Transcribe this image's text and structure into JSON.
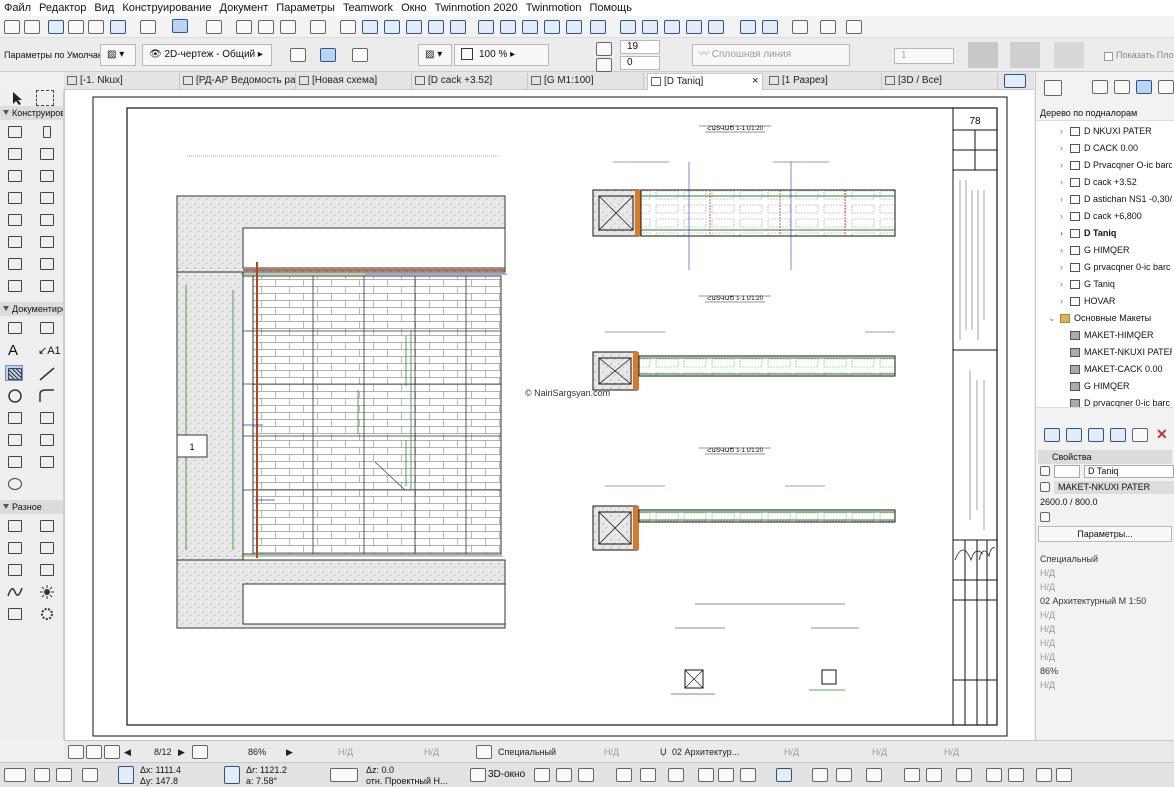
{
  "menu": [
    "Файл",
    "Редактор",
    "Вид",
    "Конструирование",
    "Документ",
    "Параметры",
    "Teamwork",
    "Окно",
    "Twinmotion 2020",
    "Twinmotion",
    "Помощь"
  ],
  "infobox": {
    "defaults_label": "Параметры по Умолчанию",
    "view_type": "2D-чертеж - Общий",
    "scale_pct": "100 %",
    "value_1": "19",
    "value_2": "0",
    "line_type": "Сплошная линия",
    "value_3": "1",
    "show_checkbox": "Показать Площ"
  },
  "tabs": [
    {
      "label": "[-1. Nkux]"
    },
    {
      "label": "[РД-АР Ведомость ра..."
    },
    {
      "label": "[Новая схема]"
    },
    {
      "label": "[D cack +3.52]"
    },
    {
      "label": "[G M1:100]"
    },
    {
      "label": "[D Taniq]",
      "active": true
    },
    {
      "label": "[1 Разрез]"
    },
    {
      "label": "[3D / Все]"
    }
  ],
  "tab_close": "×",
  "toolbox": {
    "sections": [
      "Конструирова",
      "Документиро",
      "Разное"
    ],
    "label_tool": "A1"
  },
  "drawing": {
    "sheet_number": "78",
    "watermark": "© NairiSargsyan.com",
    "detail_number": "1",
    "section_titles": [
      "ՀԱՏՎԱԾ 1-1 Մ1:20",
      "ՀԱՏՎԱԾ 1-1 Մ1:20",
      "ՀԱՏՎԱԾ 1-1 Մ1:20"
    ]
  },
  "navigator": {
    "header": "Дерево по подналорам",
    "items": [
      {
        "label": "D NKUXI PATER"
      },
      {
        "label": "D CACK 0.00"
      },
      {
        "label": "D Prvacqner O-ic barc"
      },
      {
        "label": "D cack +3.52"
      },
      {
        "label": "D astichan NS1 -0,30/"
      },
      {
        "label": "D cack +6,800"
      },
      {
        "label": "D Taniq",
        "selected": true
      },
      {
        "label": "G HIMQER"
      },
      {
        "label": "G prvacqner 0-ic barc"
      },
      {
        "label": "G Taniq"
      },
      {
        "label": "HOVAR"
      }
    ],
    "folder": "Основные Макеты",
    "layouts": [
      {
        "label": "MAKET-HIMQER"
      },
      {
        "label": "MAKET-NKUXI PATER"
      },
      {
        "label": "MAKET-CACK 0.00"
      },
      {
        "label": "G HIMQER"
      },
      {
        "label": "D prvacqner 0-ic barc"
      }
    ]
  },
  "properties": {
    "header": "Свойства",
    "name": "D Taniq",
    "layout": "MAKET-NKUXI PATER",
    "size": "2600.0 / 800.0",
    "params_button": "Параметры...",
    "list": [
      {
        "label": "Специальный",
        "dim": false
      },
      {
        "label": "Н/Д",
        "dim": true
      },
      {
        "label": "Н/Д",
        "dim": true
      },
      {
        "label": "02 Архитектурный М 1:50",
        "dim": false
      },
      {
        "label": "Н/Д",
        "dim": true
      },
      {
        "label": "Н/Д",
        "dim": true
      },
      {
        "label": "Н/Д",
        "dim": true
      },
      {
        "label": "Н/Д",
        "dim": true
      },
      {
        "label": "86%",
        "dim": false
      },
      {
        "label": "Н/Д",
        "dim": true
      }
    ]
  },
  "status": {
    "page": "8/12",
    "zoom": "86%",
    "nd1": "Н/Д",
    "nd2": "Н/Д",
    "layer": "Специальный",
    "nd3": "Н/Д",
    "pen": "02 Архитектур...",
    "nd4": "Н/Д",
    "nd5": "Н/Д",
    "nd6": "Н/Д"
  },
  "coordinates": {
    "dx": "Δx: 1111.4",
    "dy": "Δy: 147.8",
    "dr": "Δr: 1121.2",
    "angle": "a: 7.58°",
    "dz": "Δz: 0.0",
    "ref": "отн. Проектный Н..."
  },
  "bottom": {
    "view_3d": "3D-окно"
  }
}
